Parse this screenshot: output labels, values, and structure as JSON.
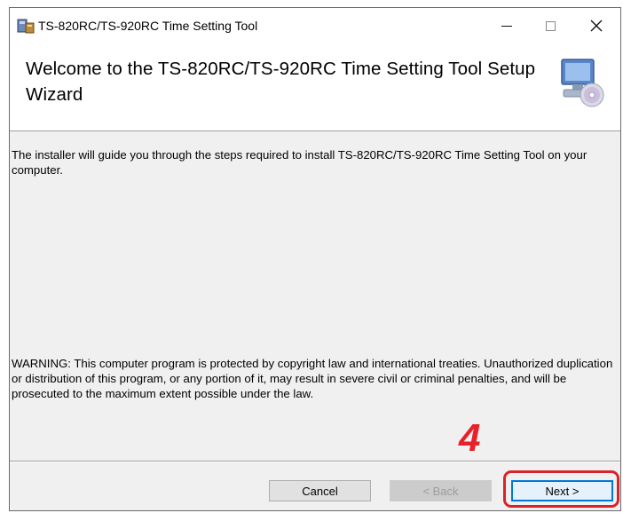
{
  "window": {
    "title": "TS-820RC/TS-920RC Time Setting Tool",
    "controls": {
      "minimize": "—",
      "maximize": "□",
      "close": "✕"
    }
  },
  "header": {
    "welcome": "Welcome to the TS-820RC/TS-920RC Time Setting Tool Setup Wizard",
    "icon": "computer-cd-icon"
  },
  "body": {
    "guide_text": "The installer will guide you through the steps required to install TS-820RC/TS-920RC Time Setting Tool on your computer.",
    "warning_text": "WARNING: This computer program is protected by copyright law and international treaties. Unauthorized duplication or distribution of this program, or any portion of it, may result in severe civil or criminal penalties, and will be prosecuted to the maximum extent possible under the law."
  },
  "annotation": {
    "step_number": "4",
    "color": "#e8202a"
  },
  "buttons": {
    "cancel": "Cancel",
    "back": "< Back",
    "next": "Next >"
  }
}
